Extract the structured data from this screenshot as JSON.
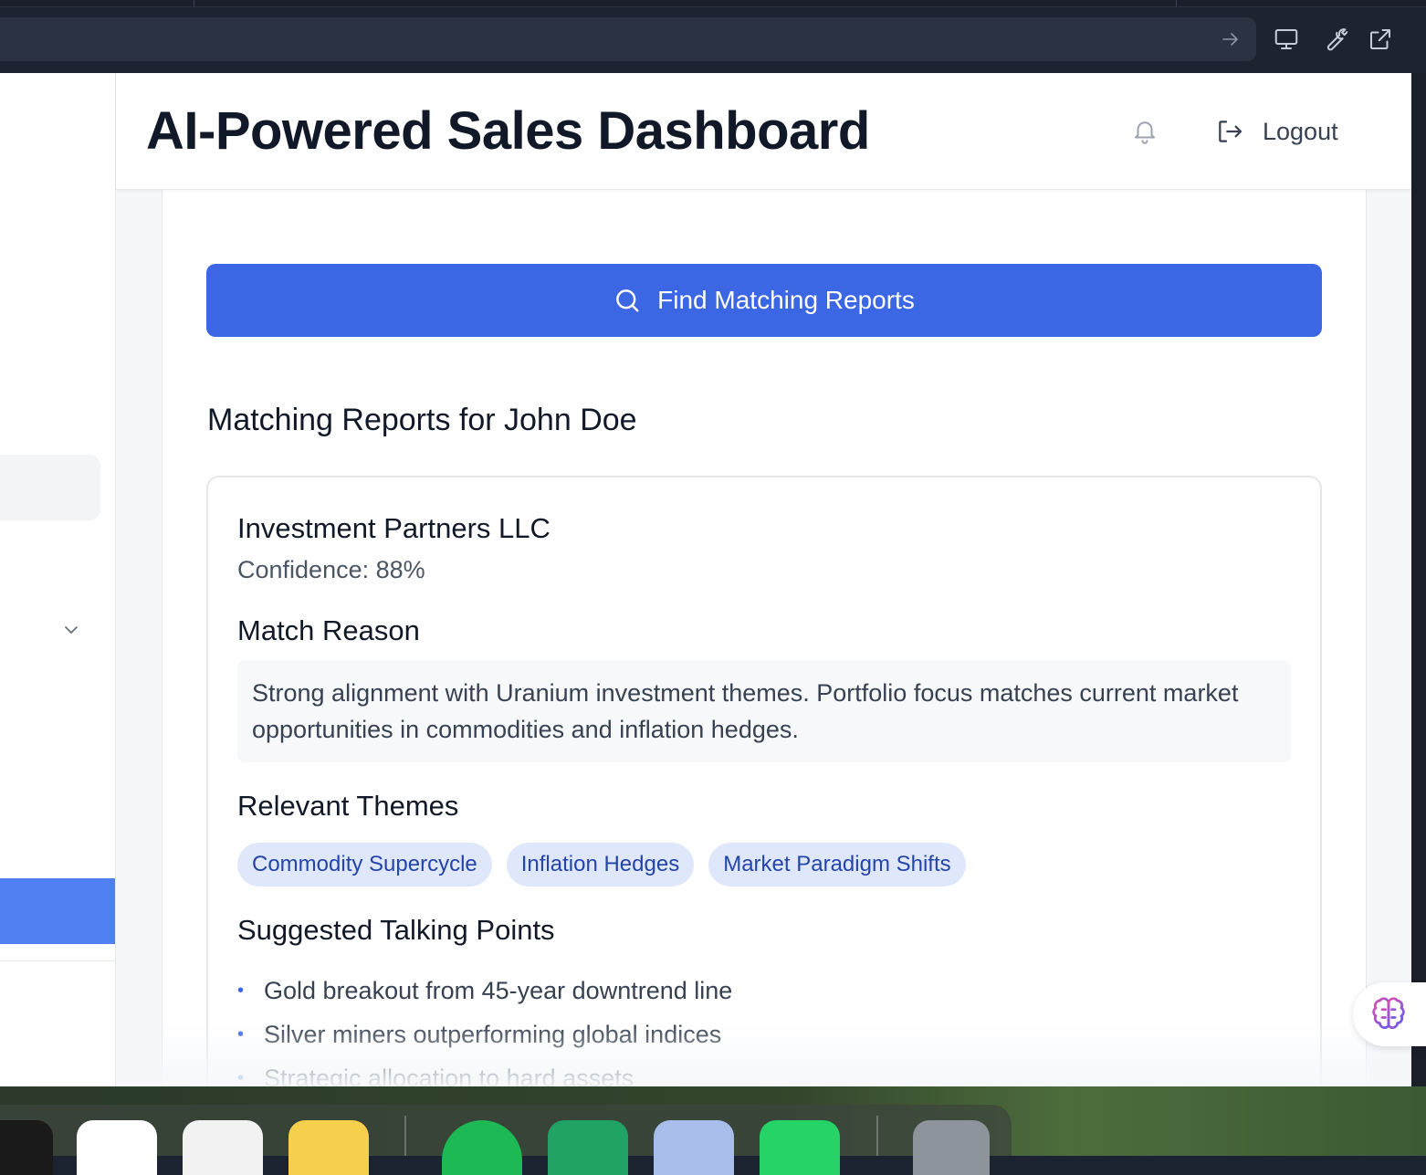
{
  "browser": {
    "icons": [
      "arrow-right-icon",
      "monitor-icon",
      "wrench-icon",
      "external-link-icon"
    ]
  },
  "header": {
    "title": "AI-Powered Sales Dashboard",
    "logout_label": "Logout"
  },
  "search": {
    "button_label": "Find Matching Reports"
  },
  "results": {
    "section_title": "Matching Reports for John Doe",
    "card": {
      "company": "Investment Partners LLC",
      "confidence": "Confidence: 88%",
      "match_reason_heading": "Match Reason",
      "match_reason": "Strong alignment with Uranium investment themes. Portfolio focus matches current market opportunities in commodities and inflation hedges.",
      "themes_heading": "Relevant Themes",
      "themes": [
        "Commodity Supercycle",
        "Inflation Hedges",
        "Market Paradigm Shifts"
      ],
      "talking_points_heading": "Suggested Talking Points",
      "talking_points": [
        "Gold breakout from 45-year downtrend line",
        "Silver miners outperforming global indices",
        "Strategic allocation to hard assets"
      ]
    }
  },
  "colors": {
    "primary": "#3b66e4",
    "sidebar_active": "#4f7ff0",
    "chip_bg": "#dfe8fb",
    "chip_text": "#2444a8",
    "title_text": "#111827"
  }
}
